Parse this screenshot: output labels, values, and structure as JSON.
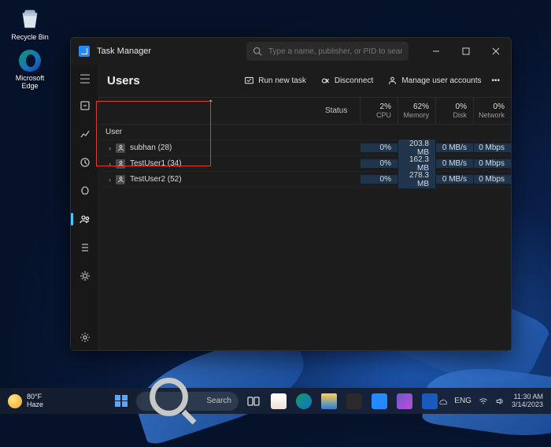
{
  "desktop": {
    "recycle_bin": "Recycle Bin",
    "edge": "Microsoft Edge"
  },
  "window": {
    "title": "Task Manager",
    "search_placeholder": "Type a name, publisher, or PID to search",
    "page_title": "Users",
    "actions": {
      "run_task": "Run new task",
      "disconnect": "Disconnect",
      "manage": "Manage user accounts"
    },
    "columns": {
      "name_group": "User",
      "status": "Status",
      "cpu_pct": "2%",
      "cpu_lbl": "CPU",
      "mem_pct": "62%",
      "mem_lbl": "Memory",
      "disk_pct": "0%",
      "disk_lbl": "Disk",
      "net_pct": "0%",
      "net_lbl": "Network"
    },
    "rows": [
      {
        "name": "subhan (28)",
        "cpu": "0%",
        "mem": "203.8 MB",
        "disk": "0 MB/s",
        "net": "0 Mbps"
      },
      {
        "name": "TestUser1 (34)",
        "cpu": "0%",
        "mem": "162.3 MB",
        "disk": "0 MB/s",
        "net": "0 Mbps"
      },
      {
        "name": "TestUser2 (52)",
        "cpu": "0%",
        "mem": "278.3 MB",
        "disk": "0 MB/s",
        "net": "0 Mbps"
      }
    ]
  },
  "taskbar": {
    "temp": "80°F",
    "cond": "Haze",
    "search": "Search",
    "time": "11:30 AM",
    "date": "3/14/2023"
  }
}
